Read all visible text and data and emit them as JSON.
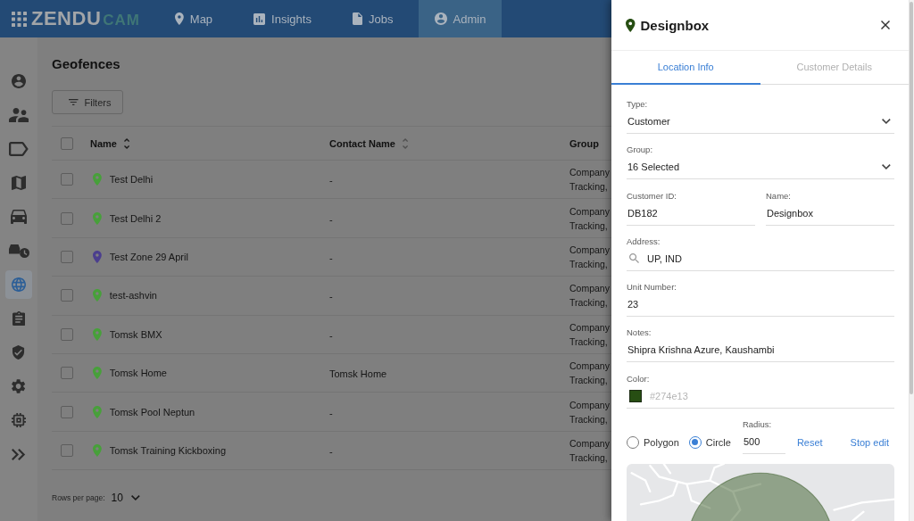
{
  "header": {
    "logo": {
      "primary": "ZENDU",
      "secondary": "CAM"
    },
    "nav": [
      {
        "label": "Map",
        "selected": false
      },
      {
        "label": "Insights",
        "selected": false
      },
      {
        "label": "Jobs",
        "selected": false
      },
      {
        "label": "Admin",
        "selected": true
      }
    ]
  },
  "sidebar": {
    "items": [
      {
        "selected": false
      },
      {
        "selected": false
      },
      {
        "selected": false
      },
      {
        "selected": false
      },
      {
        "selected": false
      },
      {
        "selected": false
      },
      {
        "selected": true
      },
      {
        "selected": false
      },
      {
        "selected": false
      },
      {
        "selected": false
      },
      {
        "selected": false
      }
    ]
  },
  "page": {
    "title": "Geofences",
    "filters_button": "Filters"
  },
  "table": {
    "select_all_checked": false,
    "columns": [
      {
        "label": "Name",
        "sortable": true,
        "sorted": true
      },
      {
        "label": "Contact Name",
        "sortable": true,
        "sorted": false
      },
      {
        "label": "Group",
        "sortable": false,
        "sorted": false
      }
    ],
    "rows": [
      {
        "checked": false,
        "color": "#47a03a",
        "name": "Test Delhi",
        "contact": "-",
        "group": "Company Tracking,"
      },
      {
        "checked": false,
        "color": "#47a03a",
        "name": "Test Delhi 2",
        "contact": "-",
        "group": "Company Tracking,"
      },
      {
        "checked": false,
        "color": "#4b3e8e",
        "name": "Test Zone 29 April",
        "contact": "-",
        "group": "Company Tracking,"
      },
      {
        "checked": false,
        "color": "#47a03a",
        "name": "test-ashvin",
        "contact": "-",
        "group": "Company Tracking,"
      },
      {
        "checked": false,
        "color": "#47a03a",
        "name": "Tomsk BMX",
        "contact": "-",
        "group": "Company Tracking,"
      },
      {
        "checked": false,
        "color": "#47a03a",
        "name": "Tomsk Home",
        "contact": "Tomsk Home",
        "group": "Company Tracking,"
      },
      {
        "checked": false,
        "color": "#47a03a",
        "name": "Tomsk Pool Neptun",
        "contact": "-",
        "group": "Company Tracking,"
      },
      {
        "checked": false,
        "color": "#47a03a",
        "name": "Tomsk Training Kickboxing",
        "contact": "-",
        "group": "Company Tracking,"
      }
    ]
  },
  "pagination": {
    "label": "Rows per page:",
    "value": "10"
  },
  "drawer": {
    "title": "Designbox",
    "tabs": [
      {
        "label": "Location Info",
        "selected": true
      },
      {
        "label": "Customer Details",
        "selected": false
      }
    ],
    "form": [
      {
        "fields": [
          {
            "kind": "select",
            "label": "Type:",
            "value": "Customer"
          }
        ]
      },
      {
        "fields": [
          {
            "kind": "select",
            "label": "Group:",
            "value": "16 Selected"
          }
        ]
      },
      {
        "fields": [
          {
            "kind": "text",
            "label": "Customer ID:",
            "value": "DB182"
          },
          {
            "kind": "text",
            "label": "Name:",
            "value": "Designbox"
          }
        ]
      },
      {
        "fields": [
          {
            "kind": "search",
            "label": "Address:",
            "value": "UP, IND"
          }
        ]
      },
      {
        "fields": [
          {
            "kind": "text",
            "label": "Unit Number:",
            "value": "23"
          }
        ]
      },
      {
        "fields": [
          {
            "kind": "text",
            "label": "Notes:",
            "value": "Shipra Krishna Azure, Kaushambi"
          }
        ]
      },
      {
        "fields": [
          {
            "kind": "color",
            "label": "Color:",
            "value": "#274e13"
          }
        ]
      }
    ],
    "shape": {
      "options": [
        {
          "label": "Polygon",
          "selected": false
        },
        {
          "label": "Circle",
          "selected": true
        }
      ],
      "radius": {
        "label": "Radius:",
        "value": "500"
      },
      "actions": [
        "Reset",
        "Stop edit"
      ]
    }
  }
}
